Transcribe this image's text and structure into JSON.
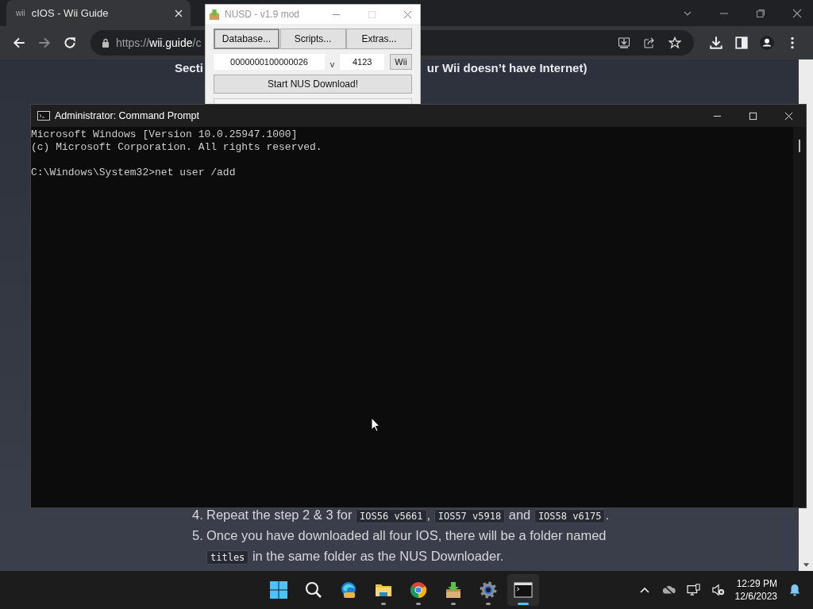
{
  "browser": {
    "tab": {
      "favicon": "wii",
      "title": "cIOS - Wii Guide"
    },
    "url": "https://**wii.guide**/c",
    "page": {
      "heading_left": "Secti",
      "heading_right": "ur Wii doesn’t have Internet)",
      "steps": [
        {
          "number": "4.",
          "parts": [
            {
              "kind": "text",
              "text": "Repeat the step 2 & 3 for "
            },
            {
              "kind": "code",
              "text": "IOS56 v5661"
            },
            {
              "kind": "text",
              "text": ", "
            },
            {
              "kind": "code",
              "text": "IOS57 v5918"
            },
            {
              "kind": "text",
              "text": " and "
            },
            {
              "kind": "code",
              "text": "IOS58 v6175"
            },
            {
              "kind": "text",
              "text": "."
            }
          ]
        },
        {
          "number": "5.",
          "parts": [
            {
              "kind": "text",
              "text": "Once you have downloaded all four IOS, there will be a folder named "
            },
            {
              "kind": "code",
              "text": "titles"
            },
            {
              "kind": "text",
              "text": " in the same folder as the NUS Downloader."
            }
          ]
        }
      ]
    }
  },
  "nusd": {
    "title": "NUSD - v1.9 mod",
    "buttons": [
      "Database...",
      "Scripts...",
      "Extras..."
    ],
    "title_id": "0000000100000026",
    "version_label": "v",
    "version": "4123",
    "platform_button": "Wii",
    "start_button": "Start NUS Download!"
  },
  "cmd": {
    "title": "Administrator: Command Prompt",
    "output": [
      "Microsoft Windows [Version 10.0.25947.1000]",
      "(c) Microsoft Corporation. All rights reserved."
    ],
    "prompt": "C:\\Windows\\System32>net user /add"
  },
  "taskbar": {
    "apps": [
      {
        "kind": "start",
        "running": false,
        "selected": false
      },
      {
        "kind": "search",
        "running": false,
        "selected": false
      },
      {
        "kind": "edge",
        "running": false,
        "selected": false
      },
      {
        "kind": "folder",
        "running": true,
        "selected": false
      },
      {
        "kind": "chrome",
        "running": true,
        "selected": false
      },
      {
        "kind": "installer",
        "running": true,
        "selected": false
      },
      {
        "kind": "gear",
        "running": true,
        "selected": false
      },
      {
        "kind": "terminal",
        "running": true,
        "selected": true
      }
    ],
    "time": "12:29 PM",
    "date": "12/6/2023"
  }
}
